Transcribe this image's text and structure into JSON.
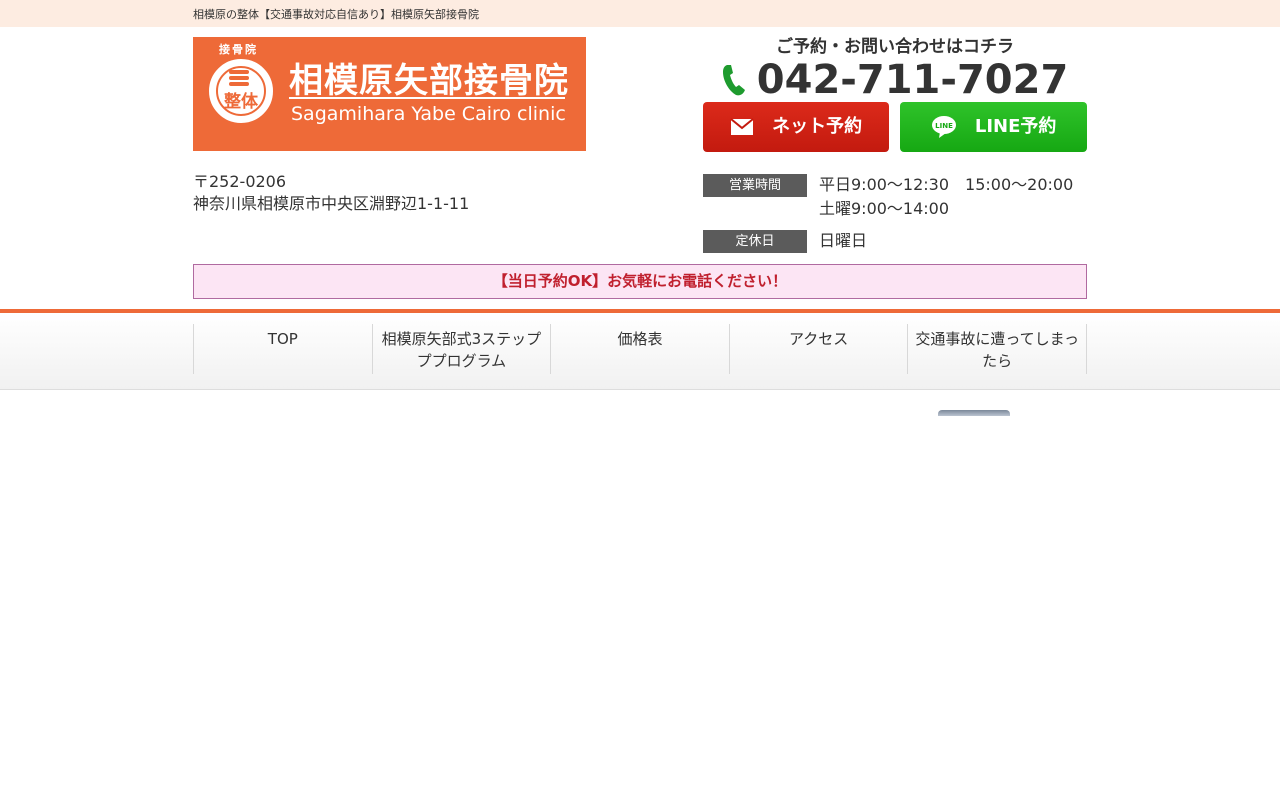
{
  "topbar": {
    "text": "相模原の整体【交通事故対応自信あり】相模原矢部接骨院"
  },
  "logo": {
    "top_text": "接骨院",
    "emblem_text": "整体",
    "title": "相模原矢部接骨院",
    "subtitle": "Sagamihara Yabe Cairo clinic"
  },
  "contact": {
    "lead": "ご予約・お問い合わせはコチラ",
    "phone": "042-711-7027",
    "phone_icon": "phone-icon",
    "buttons": {
      "net_label": "ネット予約",
      "net_icon": "mail-icon",
      "line_label": "LINE予約",
      "line_icon": "line-icon",
      "line_icon_text": "LINE"
    }
  },
  "address": {
    "zip": "〒252-0206",
    "street": "神奈川県相模原市中央区淵野辺1-1-11"
  },
  "hours": {
    "label": "営業時間",
    "weekday": "平日9:00〜12:30　15:00〜20:00",
    "saturday": "土曜9:00〜14:00",
    "closed_label": "定休日",
    "closed_value": "日曜日"
  },
  "notice": "【当日予約OK】お気軽にお電話ください！",
  "nav": {
    "items": [
      "TOP",
      "相模原矢部式3ステップププログラム",
      "価格表",
      "アクセス",
      "交通事故に遭ってしまったら"
    ]
  },
  "colors": {
    "brand_orange": "#ee6a38",
    "net_button": "#d22416",
    "line_button": "#22b51e",
    "notice_bg": "#fce5f4",
    "notice_text": "#c0202e"
  }
}
